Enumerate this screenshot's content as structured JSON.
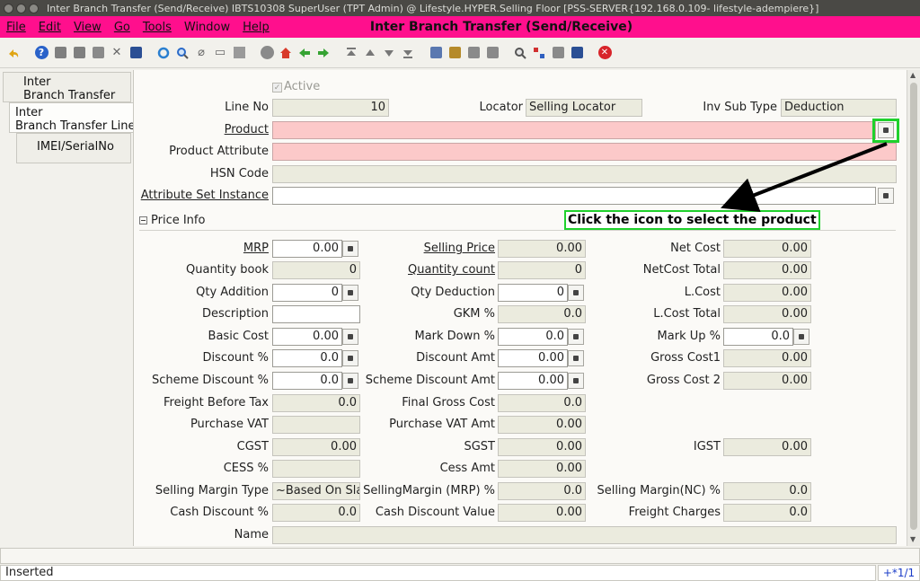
{
  "os_title": "Inter Branch Transfer (Send/Receive)  IBTS10308  SuperUser (TPT Admin) @            Lifestyle.HYPER.Selling Floor [PSS-SERVER{192.168.0.109-          lifestyle-adempiere}]",
  "window_title": "Inter Branch Transfer (Send/Receive)",
  "menu": [
    "File",
    "Edit",
    "View",
    "Go",
    "Tools",
    "Window",
    "Help"
  ],
  "tabs": [
    "Inter\nBranch Transfer",
    "Inter\nBranch Transfer Line",
    "IMEI/SerialNo"
  ],
  "header": {
    "active_label": "Active",
    "line_no_label": "Line No",
    "line_no_value": "10",
    "locator_label": "Locator",
    "locator_value": "Selling Locator",
    "inv_sub_type_label": "Inv Sub Type",
    "inv_sub_type_value": "Deduction",
    "product_label": "Product",
    "product_attribute_label": "Product Attribute",
    "hsn_code_label": "HSN Code",
    "attribute_set_instance_label": "Attribute Set Instance"
  },
  "section_title": "Price Info",
  "callout_text": "Click the icon to select the product",
  "price": {
    "mrp_label": "MRP",
    "mrp_value": "0.00",
    "quantity_book_label": "Quantity book",
    "quantity_book_value": "0",
    "qty_addition_label": "Qty Addition",
    "qty_addition_value": "0",
    "description_label": "Description",
    "description_value": "",
    "basic_cost_label": "Basic Cost",
    "basic_cost_value": "0.00",
    "discount_pct_label": "Discount %",
    "discount_pct_value": "0.0",
    "scheme_discount_pct_label": "Scheme Discount %",
    "scheme_discount_pct_value": "0.0",
    "freight_before_tax_label": "Freight Before Tax",
    "freight_before_tax_value": "0.0",
    "purchase_vat_label": "Purchase VAT",
    "purchase_vat_value": "",
    "cgst_label": "CGST",
    "cgst_value": "0.00",
    "cess_pct_label": "CESS %",
    "cess_pct_value": "",
    "selling_margin_type_label": "Selling Margin Type",
    "selling_margin_type_value": "~Based On Slal",
    "cash_discount_pct_label": "Cash Discount %",
    "cash_discount_pct_value": "0.0",
    "name_label": "Name",
    "name_value": "",
    "selling_price_label": "Selling Price",
    "selling_price_value": "0.00",
    "quantity_count_label": "Quantity count",
    "quantity_count_value": "0",
    "qty_deduction_label": "Qty Deduction",
    "qty_deduction_value": "0",
    "gkm_pct_label": "GKM %",
    "gkm_pct_value": "0.0",
    "mark_down_pct_label": "Mark Down %",
    "mark_down_pct_value": "0.0",
    "discount_amt_label": "Discount Amt",
    "discount_amt_value": "0.00",
    "scheme_discount_amt_label": "Scheme Discount Amt",
    "scheme_discount_amt_value": "0.00",
    "final_gross_cost_label": "Final Gross Cost",
    "final_gross_cost_value": "0.0",
    "purchase_vat_amt_label": "Purchase VAT Amt",
    "purchase_vat_amt_value": "0.00",
    "sgst_label": "SGST",
    "sgst_value": "0.00",
    "cess_amt_label": "Cess Amt",
    "cess_amt_value": "0.00",
    "selling_margin_mrp_label": "SellingMargin (MRP) %",
    "selling_margin_mrp_value": "0.0",
    "cash_discount_value_label": "Cash Discount Value",
    "cash_discount_value_value": "0.00",
    "net_cost_label": "Net Cost",
    "net_cost_value": "0.00",
    "netcost_total_label": "NetCost Total",
    "netcost_total_value": "0.00",
    "l_cost_label": "L.Cost",
    "l_cost_value": "0.00",
    "l_cost_total_label": "L.Cost Total",
    "l_cost_total_value": "0.00",
    "mark_up_pct_label": "Mark Up %",
    "mark_up_pct_value": "0.0",
    "gross_cost1_label": "Gross Cost1",
    "gross_cost1_value": "0.00",
    "gross_cost2_label": "Gross Cost 2",
    "gross_cost2_value": "0.00",
    "igst_label": "IGST",
    "igst_value": "0.00",
    "selling_margin_nc_label": "Selling Margin(NC) %",
    "selling_margin_nc_value": "0.0",
    "freight_charges_label": "Freight Charges",
    "freight_charges_value": "0.0"
  },
  "status": {
    "message": "Inserted",
    "nav": "+*1/1"
  },
  "icons": [
    "undo-icon",
    "help-icon",
    "new-icon",
    "copy-icon",
    "delete-icon",
    "save-icon",
    "refresh-icon",
    "find-icon",
    "attachment-icon",
    "chat-icon",
    "grid-toggle-icon",
    "history-icon",
    "home-icon",
    "back-icon",
    "forward-icon",
    "first-icon",
    "previous-icon",
    "next-icon",
    "last-icon",
    "report-icon",
    "archive-icon",
    "print-icon",
    "print-preview-icon",
    "zoom-across-icon",
    "workflow-icon",
    "request-icon",
    "product-info-icon",
    "exit-icon"
  ],
  "colors": {
    "menubar": "#ff0f8d",
    "mandatory_field": "#fcc9c9",
    "callout_border": "#1fd12c"
  }
}
